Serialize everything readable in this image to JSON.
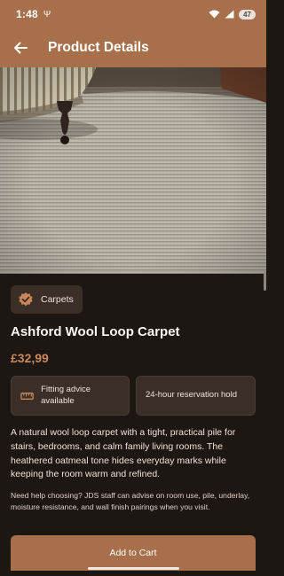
{
  "status_bar": {
    "time": "1:48",
    "usb_glyph": "Ψ",
    "battery_level": "47"
  },
  "app_bar": {
    "back_icon": "arrow-left-icon",
    "title": "Product Details"
  },
  "product": {
    "category": "Carpets",
    "category_icon": "verified-badge-icon",
    "name": "Ashford Wool Loop Carpet",
    "price": "£32,99",
    "features": [
      {
        "icon": "ruler-icon",
        "text": "Fitting advice available"
      },
      {
        "icon": "",
        "text": "24-hour reservation hold"
      }
    ],
    "description": "A natural wool loop carpet with a tight, practical pile for stairs, bedrooms, and calm family living rooms. The heathered oatmeal tone hides everyday marks while keeping the room warm and refined.",
    "help_text": "Need help choosing? JDS staff can advise on room use, pile, underlay, moisture resistance, and wall finish pairings when you visit."
  },
  "actions": {
    "add_to_cart": "Add to Cart"
  },
  "colors": {
    "accent": "#a8704a",
    "background": "#1d1714",
    "card": "#3a2e27",
    "price": "#c9875a"
  }
}
